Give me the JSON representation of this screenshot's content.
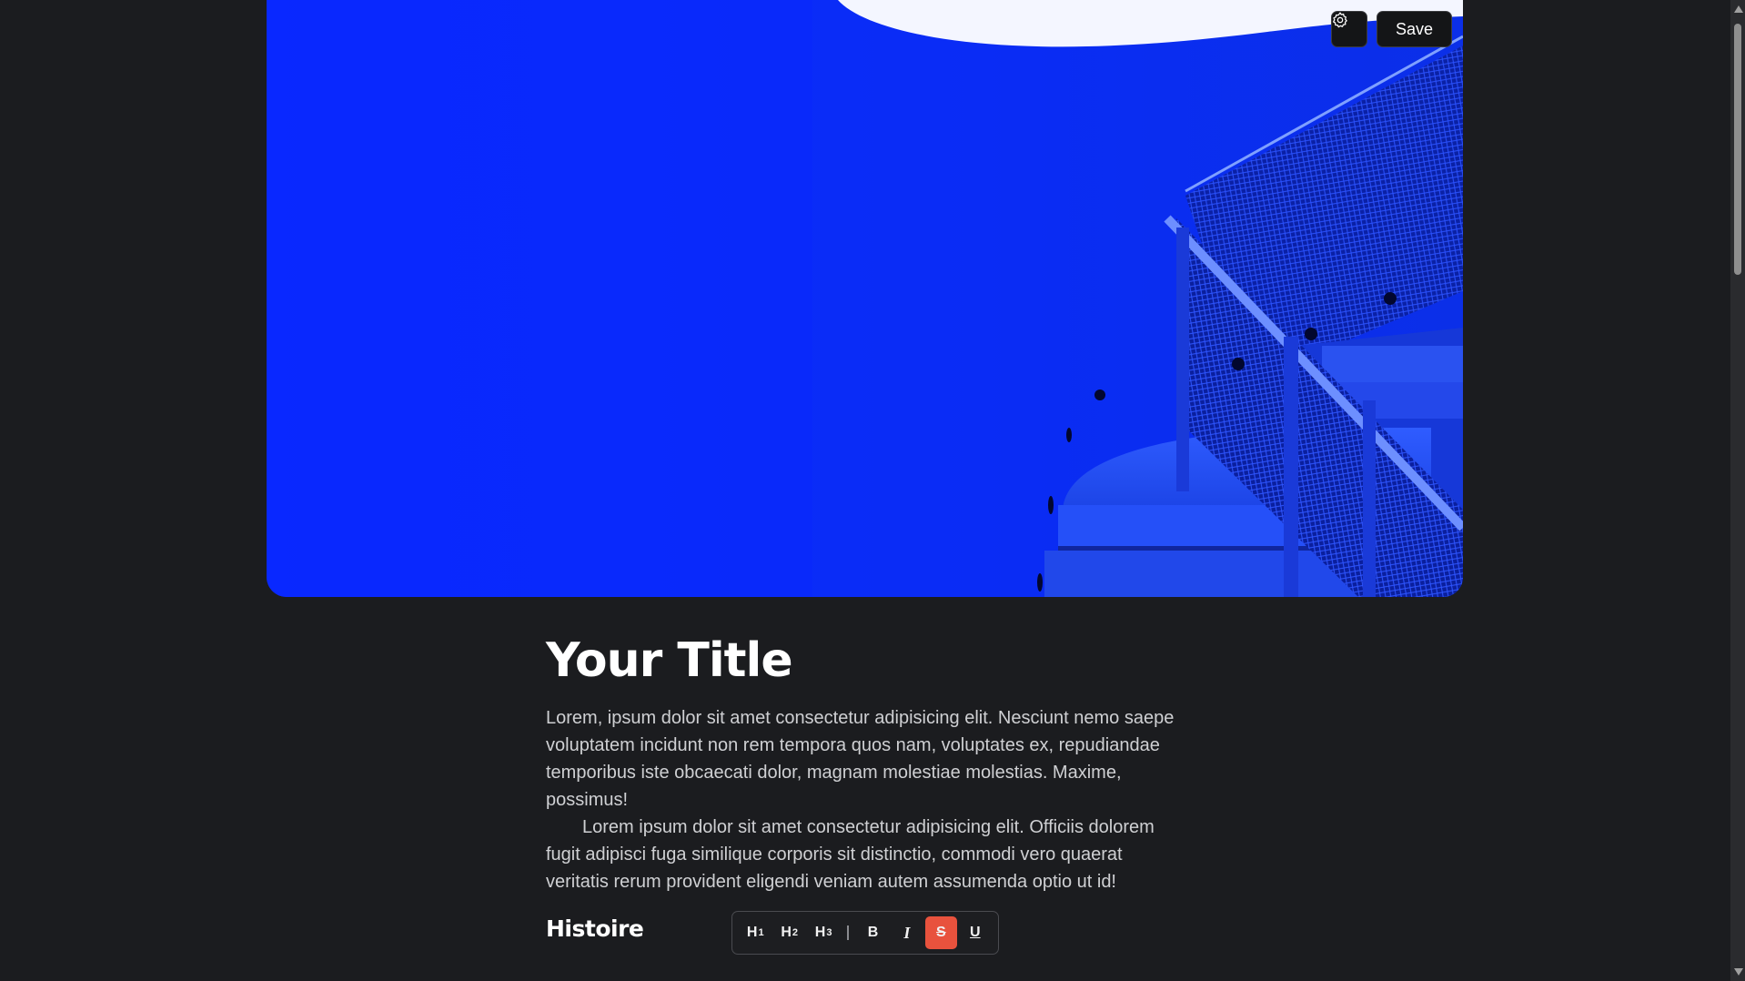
{
  "hero": {
    "image": "blue-staircase-photo",
    "settings_icon": "gear-icon",
    "save_label": "Save"
  },
  "article": {
    "title": "Your Title",
    "paragraph1": "Lorem, ipsum dolor sit amet consectetur adipisicing elit. Nesciunt nemo saepe voluptatem incidunt non rem tempora quos nam, voluptates ex, repudiandae temporibus iste obcaecati dolor, magnam molestiae molestias. Maxime, possimus!",
    "paragraph2": "Lorem ipsum dolor sit amet consectetur adipisicing elit. Officiis dolorem fugit adipisci fuga similique corporis sit distinctio, commodi vero quaerat veritatis rerum provident eligendi veniam autem assumenda optio ut id!",
    "heading2": "Histoire"
  },
  "toolbar": {
    "h1": "H",
    "h1_sub": "1",
    "h2": "H",
    "h2_sub": "2",
    "h3": "H",
    "h3_sub": "3",
    "separator": "|",
    "bold": "B",
    "italic": "I",
    "strike": "S",
    "underline": "U",
    "active_color": "#e8523d"
  }
}
